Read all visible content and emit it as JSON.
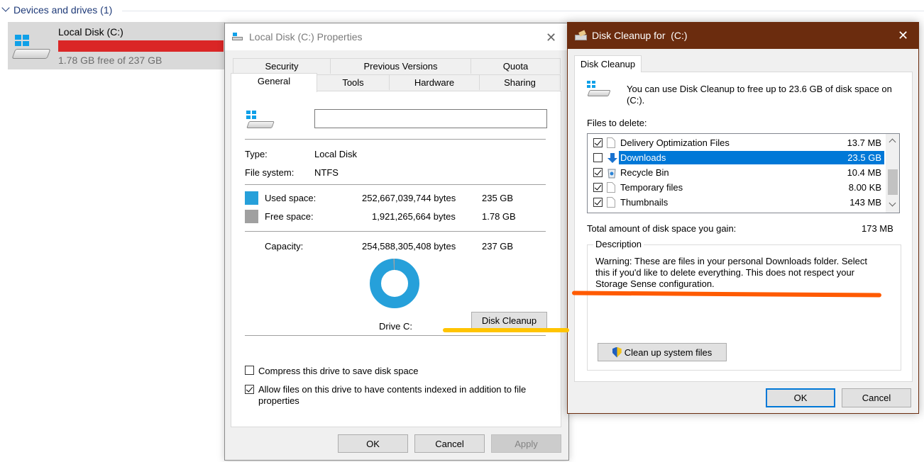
{
  "explorer": {
    "section_title": "Devices and drives (1)",
    "drive_name": "Local Disk (C:)",
    "drive_free": "1.78 GB free of 237 GB",
    "bar_fill_fraction": 0.99
  },
  "props": {
    "title": "Local Disk (C:) Properties",
    "tabs_row1": [
      "Security",
      "Previous Versions",
      "Quota"
    ],
    "tabs_row2": [
      "General",
      "Tools",
      "Hardware",
      "Sharing"
    ],
    "name_value": "",
    "type_label": "Type:",
    "type_value": "Local Disk",
    "fs_label": "File system:",
    "fs_value": "NTFS",
    "used_label": "Used space:",
    "used_bytes": "252,667,039,744 bytes",
    "used_gb": "235 GB",
    "free_label": "Free space:",
    "free_bytes": "1,921,265,664 bytes",
    "free_gb": "1.78 GB",
    "cap_label": "Capacity:",
    "cap_bytes": "254,588,305,408 bytes",
    "cap_gb": "237 GB",
    "drive_label": "Drive C:",
    "cleanup_button": "Disk Cleanup",
    "compress_label": "Compress this drive to save disk space",
    "index_label": "Allow files on this drive to have contents indexed in addition to file properties",
    "ok": "OK",
    "cancel": "Cancel",
    "apply": "Apply",
    "used_color": "#26a0da",
    "free_color": "#a0a0a0"
  },
  "cleanup": {
    "title": "Disk Cleanup for  (C:)",
    "tab": "Disk Cleanup",
    "intro": "You can use Disk Cleanup to free up to 23.6 GB of disk space on (C:).",
    "files_label": "Files to delete:",
    "files": [
      {
        "name": "Delivery Optimization Files",
        "size": "13.7 MB",
        "checked": true,
        "selected": false,
        "icon": "file-icon"
      },
      {
        "name": "Downloads",
        "size": "23.5 GB",
        "checked": false,
        "selected": true,
        "icon": "download-arrow-icon"
      },
      {
        "name": "Recycle Bin",
        "size": "10.4 MB",
        "checked": true,
        "selected": false,
        "icon": "recycle-bin-icon"
      },
      {
        "name": "Temporary files",
        "size": "8.00 KB",
        "checked": true,
        "selected": false,
        "icon": "file-icon"
      },
      {
        "name": "Thumbnails",
        "size": "143 MB",
        "checked": true,
        "selected": false,
        "icon": "file-icon"
      }
    ],
    "total_label": "Total amount of disk space you gain:",
    "total_value": "173 MB",
    "desc_label": "Description",
    "desc_text": "Warning: These are files in your personal Downloads folder. Select this if you'd like to delete everything. This does not respect your Storage Sense configuration.",
    "system_button": "Clean up system files",
    "ok": "OK",
    "cancel": "Cancel",
    "titlebar_color": "#6b2c0e"
  },
  "annotations": {
    "yellow_color": "#ffc400",
    "orange_color": "#ff5a00"
  }
}
